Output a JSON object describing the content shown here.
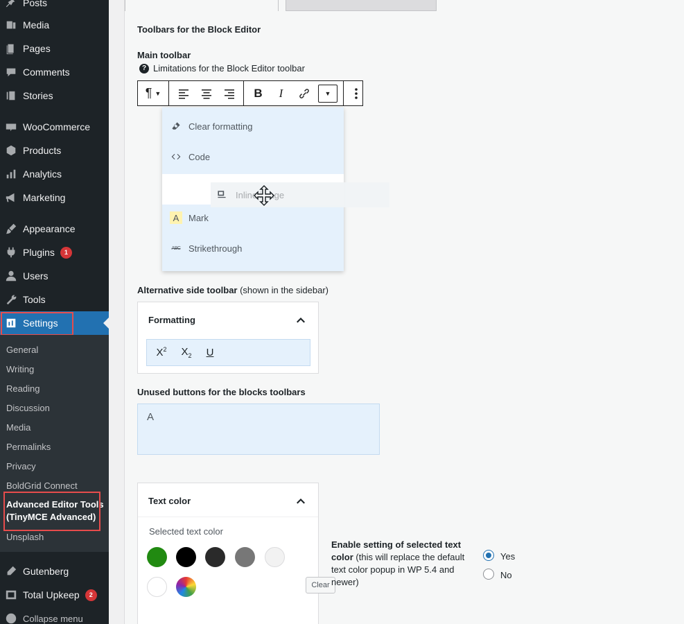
{
  "sidebar": {
    "items": [
      {
        "label": "Posts",
        "icon": "pushpin-icon"
      },
      {
        "label": "Media",
        "icon": "media-icon"
      },
      {
        "label": "Pages",
        "icon": "pages-icon"
      },
      {
        "label": "Comments",
        "icon": "comments-icon"
      },
      {
        "label": "Stories",
        "icon": "stories-icon"
      },
      {
        "label": "WooCommerce",
        "icon": "woocommerce-icon"
      },
      {
        "label": "Products",
        "icon": "products-icon"
      },
      {
        "label": "Analytics",
        "icon": "analytics-icon"
      },
      {
        "label": "Marketing",
        "icon": "megaphone-icon"
      },
      {
        "label": "Appearance",
        "icon": "brush-icon"
      },
      {
        "label": "Plugins",
        "icon": "plugins-icon",
        "badge": "1"
      },
      {
        "label": "Users",
        "icon": "users-icon"
      },
      {
        "label": "Tools",
        "icon": "wrench-icon"
      },
      {
        "label": "Settings",
        "icon": "settings-icon"
      }
    ],
    "submenu": [
      "General",
      "Writing",
      "Reading",
      "Discussion",
      "Media",
      "Permalinks",
      "Privacy",
      "BoldGrid Connect"
    ],
    "submenu_current_line1": "Advanced Editor Tools",
    "submenu_current_line2": "(TinyMCE Advanced)",
    "submenu_after": "Unsplash",
    "bottom_items": [
      {
        "label": "Gutenberg",
        "icon": "gutenberg-icon"
      },
      {
        "label": "Total Upkeep",
        "icon": "upkeep-icon",
        "badge": "2"
      },
      {
        "label": "Collapse menu",
        "icon": "collapse-icon"
      }
    ]
  },
  "content": {
    "section_title": "Toolbars for the Block Editor",
    "main_toolbar_label": "Main toolbar",
    "limitations_link": "Limitations for the Block Editor toolbar",
    "dropdown": {
      "items": [
        {
          "label": "Clear formatting",
          "icon": "eraser-icon"
        },
        {
          "label": "Code",
          "icon": "code-icon"
        },
        {
          "label": "Mark",
          "icon": "mark-icon",
          "glyph": "A"
        },
        {
          "label": "Strikethrough",
          "icon": "strikethrough-icon",
          "glyph": "ABC"
        }
      ],
      "dragging_label": "Inline image"
    },
    "alt_toolbar_label": "Alternative side toolbar",
    "alt_toolbar_note": " (shown in the sidebar)",
    "formatting_title": "Formatting",
    "unused_label": "Unused buttons for the blocks toolbars",
    "unused_glyph": "A",
    "text_color_title": "Text color",
    "selected_text_color": "Selected text color",
    "clear_label": "Clear",
    "swatches": [
      "#218a11",
      "#000000",
      "#2a2a2a",
      "#777777",
      "#f2f2f2",
      "#ffffff"
    ],
    "setting_label_bold": "Enable setting of selected text color",
    "setting_label_note": " (this will replace the default text color popup in WP 5.4 and newer)",
    "yes_label": "Yes",
    "no_label": "No"
  }
}
